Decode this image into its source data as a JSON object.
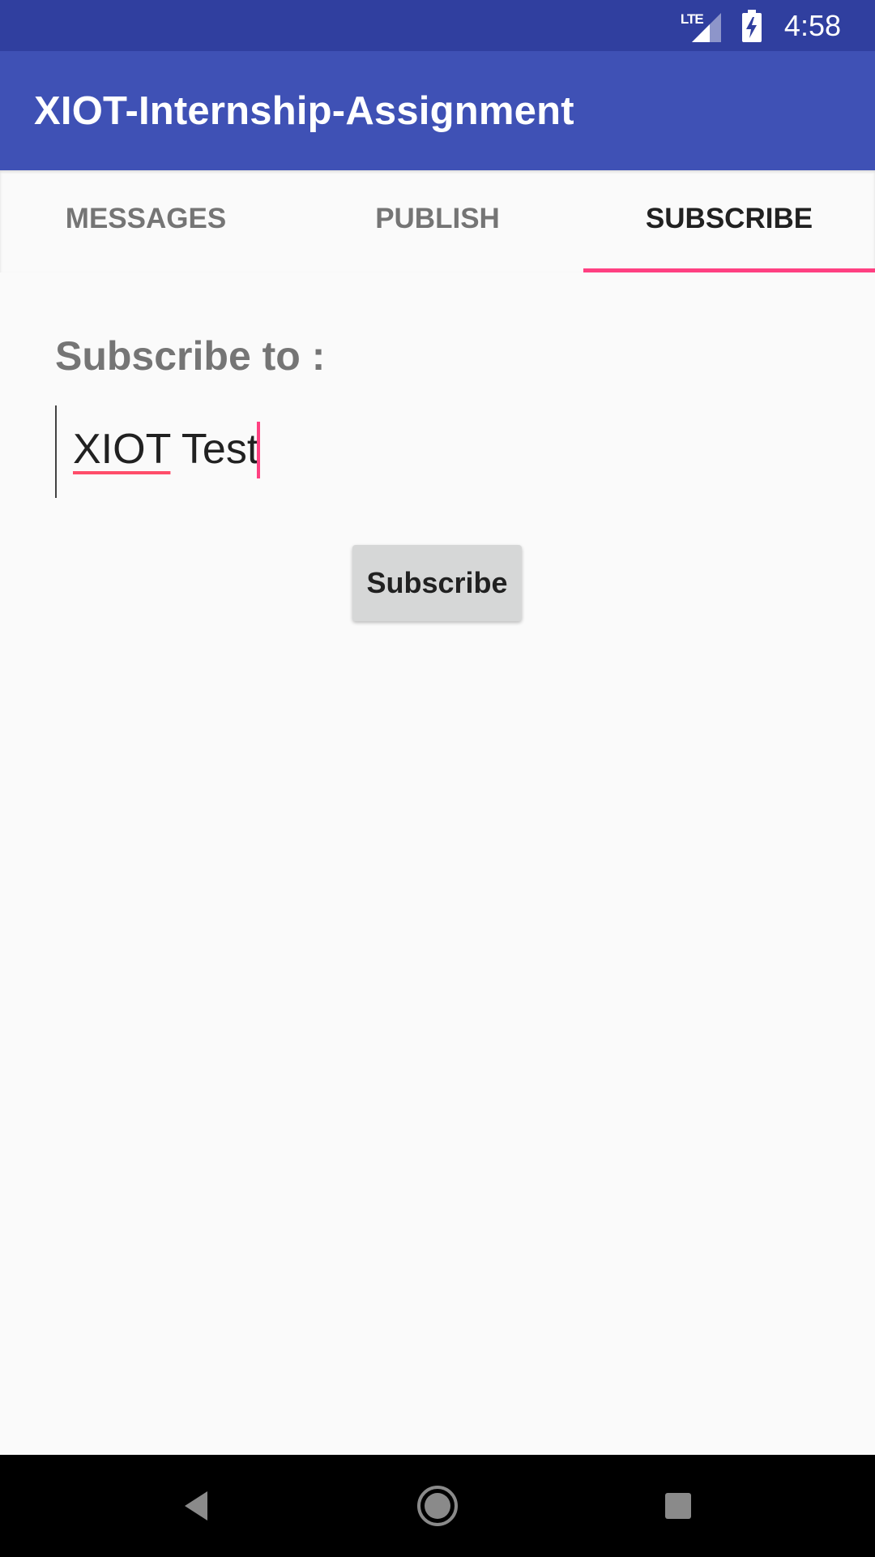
{
  "status_bar": {
    "network_label": "LTE",
    "time": "4:58"
  },
  "app_bar": {
    "title": "XIOT-Internship-Assignment"
  },
  "tabs": [
    {
      "label": "MESSAGES",
      "active": false
    },
    {
      "label": "PUBLISH",
      "active": false
    },
    {
      "label": "SUBSCRIBE",
      "active": true
    }
  ],
  "subscribe": {
    "label": "Subscribe to :",
    "input_value_word1": "XIOT",
    "input_value_word2": " Test",
    "button_label": "Subscribe"
  },
  "colors": {
    "status_bar": "#303f9f",
    "app_bar": "#3f51b5",
    "accent": "#ff4081",
    "background": "#fafafa"
  },
  "nav_bar": {
    "icons": [
      "back-icon",
      "home-icon",
      "recents-icon"
    ]
  }
}
